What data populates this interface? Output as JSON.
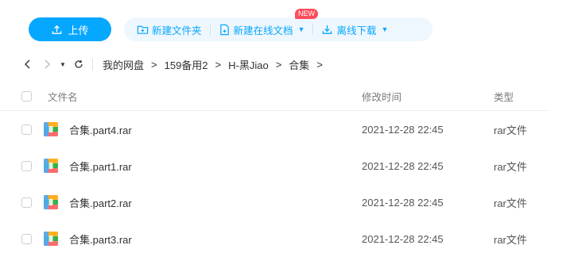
{
  "toolbar": {
    "upload_label": "上传",
    "new_folder_label": "新建文件夹",
    "new_online_doc_label": "新建在线文档",
    "new_badge": "NEW",
    "offline_download_label": "离线下载"
  },
  "nav": {
    "breadcrumbs": [
      "我的网盘",
      "159备用2",
      "H-黑Jiao",
      "合集"
    ],
    "separator": ">"
  },
  "table": {
    "columns": {
      "name": "文件名",
      "time": "修改时间",
      "type": "类型"
    },
    "rows": [
      {
        "name": "合集.part4.rar",
        "time": "2021-12-28 22:45",
        "type": "rar文件"
      },
      {
        "name": "合集.part1.rar",
        "time": "2021-12-28 22:45",
        "type": "rar文件"
      },
      {
        "name": "合集.part2.rar",
        "time": "2021-12-28 22:45",
        "type": "rar文件"
      },
      {
        "name": "合集.part3.rar",
        "time": "2021-12-28 22:45",
        "type": "rar文件"
      }
    ],
    "row_icon": "rar-archive-icon"
  },
  "colors": {
    "accent": "#06a7ff",
    "pill_bg": "#eef7fe",
    "badge": "#ff4d5b"
  }
}
